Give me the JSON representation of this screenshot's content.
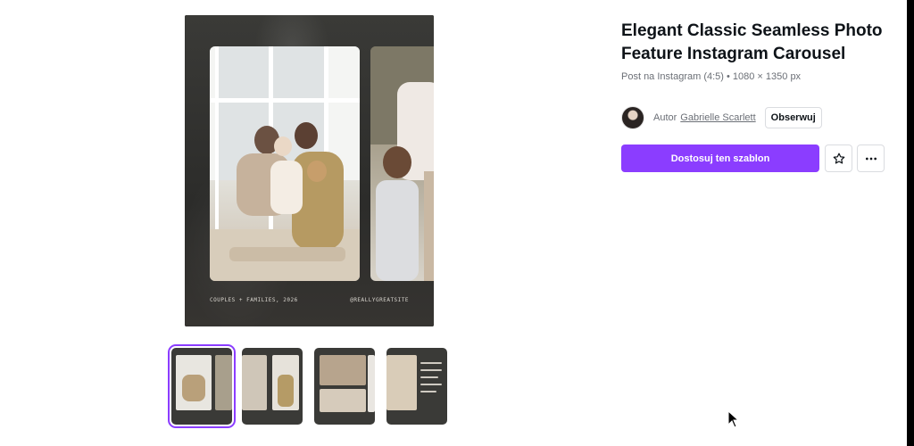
{
  "template": {
    "title": "Elegant Classic Seamless Photo Feature Instagram Carousel",
    "format": "Post na Instagram (4:5) • 1080 × 1350 px",
    "author_prefix": "Autor",
    "author_name": "Gabrielle Scarlett",
    "follow_label": "Obserwuj",
    "customize_label": "Dostosuj ten szablon"
  },
  "preview": {
    "caption_left": "COUPLES + FAMILIES, 2026",
    "caption_right": "@REALLYGREATSITE"
  },
  "thumbnails": [
    {
      "label": "page-1",
      "selected": true
    },
    {
      "label": "page-2",
      "selected": false
    },
    {
      "label": "page-3",
      "selected": false
    },
    {
      "label": "page-4",
      "selected": false
    }
  ],
  "icons": {
    "star": "star-icon",
    "more": "more-horizontal-icon",
    "cursor": "mouse-cursor-icon"
  },
  "colors": {
    "accent": "#8b3dff",
    "text": "#0e1318",
    "muted": "#6b6f76"
  }
}
